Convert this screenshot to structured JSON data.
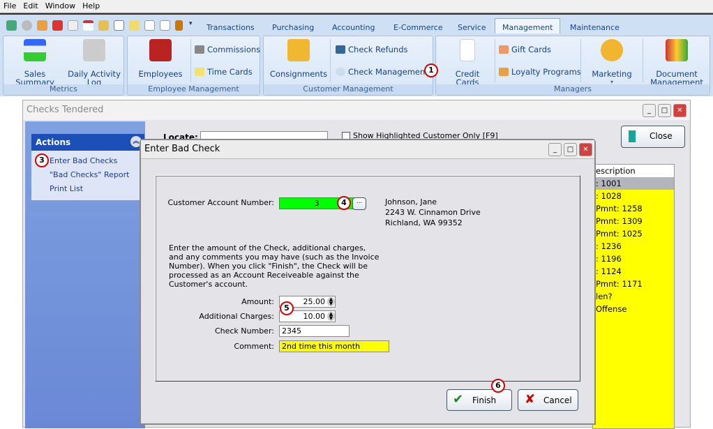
{
  "menu": [
    "File",
    "Edit",
    "Window",
    "Help"
  ],
  "ribbon": {
    "tabs": [
      "Transactions",
      "Purchasing",
      "Accounting",
      "E-Commerce",
      "Service",
      "Management",
      "Maintenance"
    ],
    "selected_tab": "Management",
    "groups": {
      "metrics": {
        "label": "Metrics",
        "sales_summary": "Sales Summary",
        "daily_log": "Daily Activity Log"
      },
      "employee": {
        "label": "Employee Management",
        "employees": "Employees",
        "commissions": "Commissions",
        "time_cards": "Time Cards"
      },
      "customer": {
        "label": "Customer Management",
        "consignments": "Consignments",
        "check_refunds": "Check Refunds",
        "check_management": "Check Management"
      },
      "managers": {
        "label": "Managers",
        "credit_cards": "Credit Cards",
        "gift_cards": "Gift Cards",
        "loyalty": "Loyalty Programs",
        "marketing": "Marketing",
        "document": "Document Management"
      }
    }
  },
  "callouts": [
    "1",
    "3",
    "4",
    "5",
    "6"
  ],
  "checks_window": {
    "title": "Checks Tendered",
    "actions_title": "Actions",
    "actions": [
      "Enter Bad Checks",
      "\"Bad Checks\" Report",
      "Print List"
    ],
    "locate_label": "Locate:",
    "locate_value": "",
    "show_highlighted": "Show Highlighted Customer Only [F9]",
    "close": "Close",
    "list_header": "escription",
    "rows": [
      ": 1001",
      ": 1028",
      " Pmnt: 1258",
      " Pmnt: 1309",
      " Pmnt: 1025",
      ": 1236",
      ": 1196",
      ": 1124",
      " Pmnt: 1171",
      "len?",
      " Offense"
    ]
  },
  "dialog": {
    "title": "Enter Bad Check",
    "account_label": "Customer Account Number:",
    "account_value": "3",
    "lookup": "...",
    "customer": {
      "name": "Johnson, Jane",
      "street": "2243 W. Cinnamon Drive",
      "city": "Richland, WA   99352"
    },
    "instructions": "Enter the amount of the Check, additional charges, and any comments you may have (such as the Invoice Number).  When you click \"Finish\", the Check will be processed as an Account Receiveable against the Customer's account.",
    "amount_label": "Amount:",
    "amount": "25.00",
    "charges_label": "Additional Charges:",
    "charges": "10.00",
    "check_label": "Check Number:",
    "check_number": "2345",
    "comment_label": "Comment:",
    "comment": "2nd time this month",
    "finish": "Finish",
    "cancel": "Cancel"
  },
  "colors": {
    "green_field": "#00ff00",
    "highlight": "#ffff00",
    "actions_header": "#1c50b8"
  }
}
